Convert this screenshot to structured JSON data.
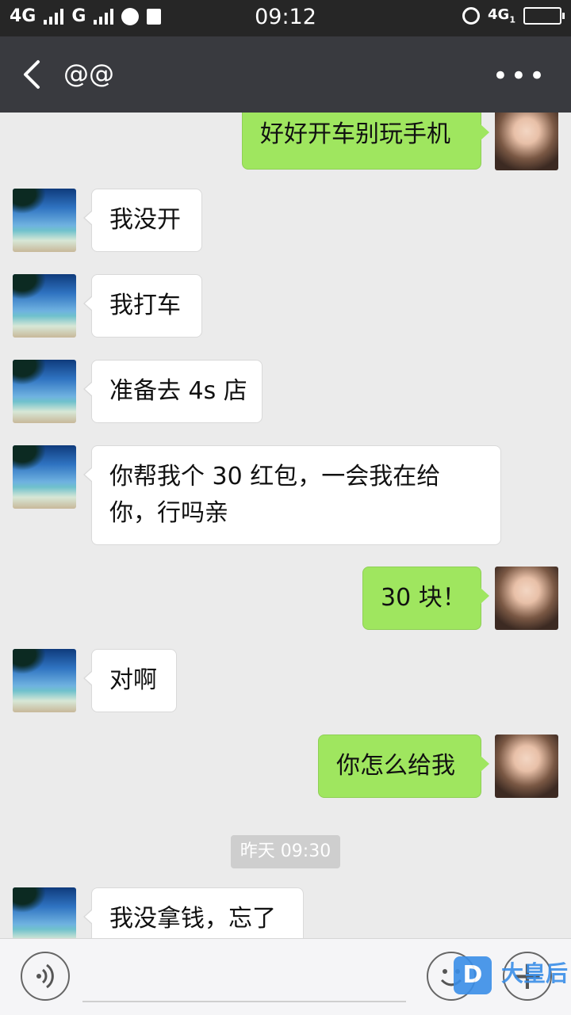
{
  "status_bar": {
    "network1": "4G",
    "network2": "G",
    "time": "09:12",
    "network3": "4G",
    "network3_sub": "1"
  },
  "header": {
    "title": "@@"
  },
  "messages": [
    {
      "side": "out",
      "text": "好好开车别玩手机"
    },
    {
      "side": "in",
      "text": "我没开"
    },
    {
      "side": "in",
      "text": "我打车"
    },
    {
      "side": "in",
      "text": "准备去 4s 店"
    },
    {
      "side": "in",
      "text": "你帮我个 30 红包，一会我在给你，行吗亲"
    },
    {
      "side": "out",
      "text": "30 块！"
    },
    {
      "side": "in",
      "text": "对啊"
    },
    {
      "side": "out",
      "text": "你怎么给我"
    },
    {
      "side": "in",
      "text": "我没拿钱，忘了"
    }
  ],
  "timestamp": "昨天 09:30",
  "input_bar": {
    "watermark": "大皇后"
  },
  "icons": {
    "back": "chevron-left-icon",
    "more": "more-dots-icon",
    "voice": "voice-icon",
    "emoji": "emoji-icon",
    "plus": "plus-icon"
  }
}
